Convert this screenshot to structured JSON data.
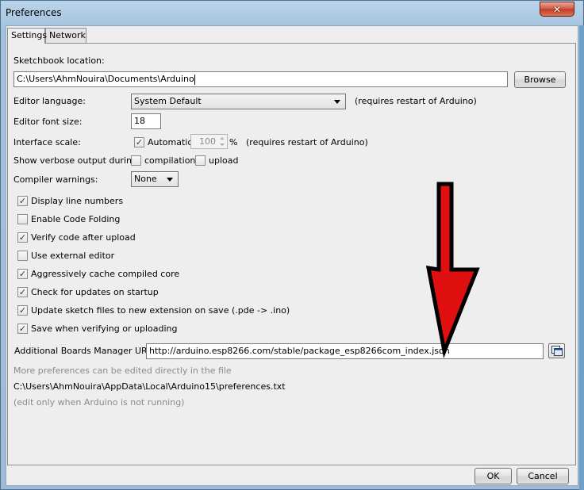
{
  "window": {
    "title": "Preferences",
    "close_label": "✕"
  },
  "tabs": [
    {
      "label": "Settings",
      "active": true
    },
    {
      "label": "Network",
      "active": false
    }
  ],
  "settings": {
    "sketchbook_label": "Sketchbook location:",
    "sketchbook_value": "C:\\Users\\AhmNouira\\Documents\\Arduino",
    "browse_label": "Browse",
    "editor_language_label": "Editor language:",
    "editor_language_value": "System Default",
    "editor_language_note": "(requires restart of Arduino)",
    "font_size_label": "Editor font size:",
    "font_size_value": "18",
    "interface_scale_label": "Interface scale:",
    "automatic_label": "Automatic",
    "scale_value": "100",
    "scale_unit": "%",
    "scale_note": "(requires restart of Arduino)",
    "verbose_label": "Show verbose output during:",
    "compilation_label": "compilation",
    "upload_label": "upload",
    "warnings_label": "Compiler warnings:",
    "warnings_value": "None",
    "checkboxes": [
      {
        "label": "Display line numbers",
        "checked": "✓"
      },
      {
        "label": "Enable Code Folding",
        "checked": ""
      },
      {
        "label": "Verify code after upload",
        "checked": "✓"
      },
      {
        "label": "Use external editor",
        "checked": ""
      },
      {
        "label": "Aggressively cache compiled core",
        "checked": "✓"
      },
      {
        "label": "Check for updates on startup",
        "checked": "✓"
      },
      {
        "label": "Update sketch files to new extension on save (.pde -> .ino)",
        "checked": "✓"
      },
      {
        "label": "Save when verifying or uploading",
        "checked": "✓"
      }
    ],
    "automatic_checked": "✓",
    "compilation_checked": "",
    "upload_checked": "",
    "boards_url_label": "Additional Boards Manager URLs:",
    "boards_url_value": "http://arduino.esp8266.com/stable/package_esp8266com_index.json",
    "more_prefs_text": "More preferences can be edited directly in the file",
    "prefs_path": "C:\\Users\\AhmNouira\\AppData\\Local\\Arduino15\\preferences.txt",
    "edit_note": "(edit only when Arduino is not running)"
  },
  "footer": {
    "ok_label": "OK",
    "cancel_label": "Cancel"
  },
  "colors": {
    "annotation_arrow": "#e01010",
    "arrow_outline": "#000000"
  }
}
